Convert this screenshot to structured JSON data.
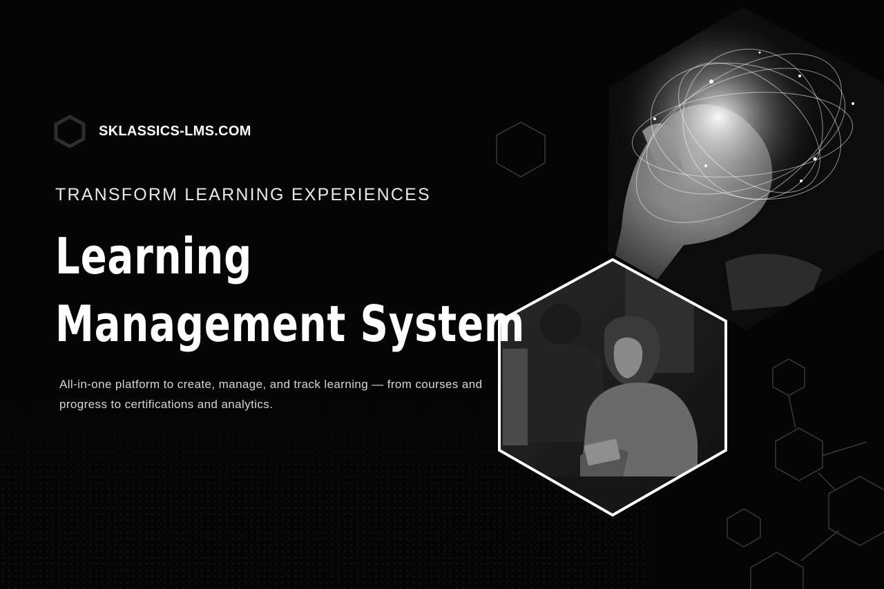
{
  "brand": {
    "icon": "hexagon-icon",
    "name": "SKLASSICS-LMS.COM"
  },
  "hero": {
    "tagline": "TRANSFORM LEARNING EXPERIENCES",
    "headline_line1": "Learning",
    "headline_line2": "Management System",
    "description": "All-in-one platform to create, manage, and track learning — from courses and progress to certifications and analytics."
  },
  "images": {
    "top": "hand-network-image",
    "bottom": "woman-laptop-image"
  },
  "colors": {
    "background": "#050505",
    "text": "#ffffff",
    "accent_outline": "#ffffff"
  }
}
